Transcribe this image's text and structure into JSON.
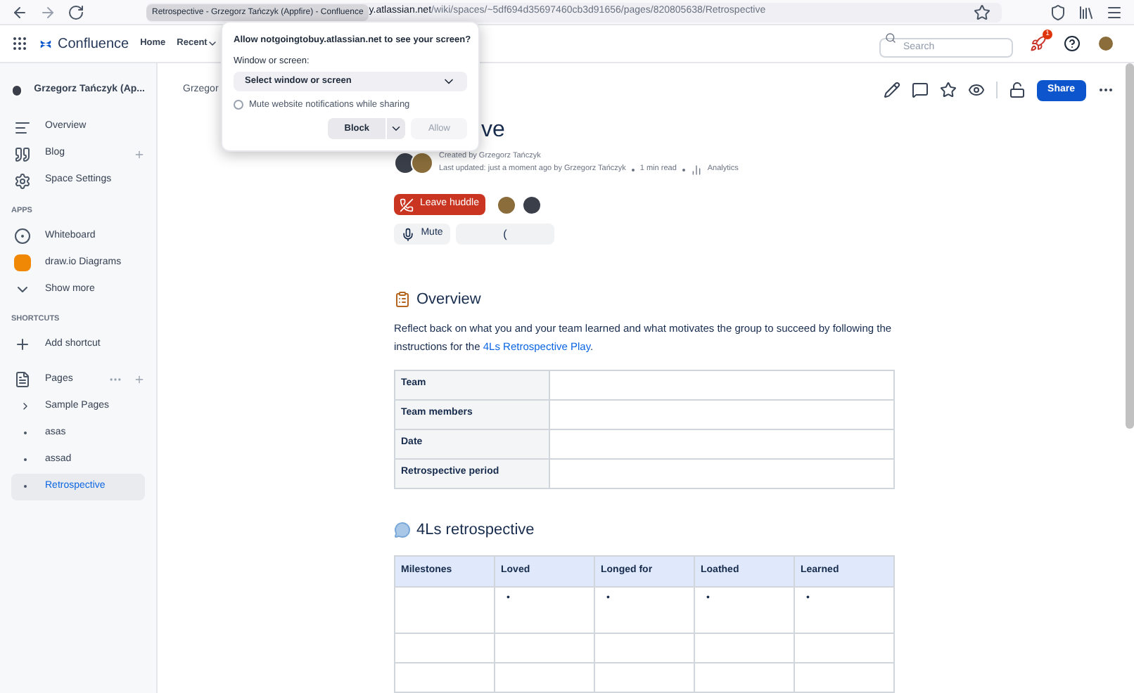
{
  "browser": {
    "tab_tooltip": "Retrospective - Grzegorz Tańczyk (Appfire) - Confluence",
    "url_host": "y.atlassian.net",
    "url_path": "/wiki/spaces/~5df694d35697460cb3d91656/pages/820805638/Retrospective"
  },
  "header": {
    "product": "Confluence",
    "nav": [
      {
        "label": "Home",
        "dropdown": false
      },
      {
        "label": "Recent",
        "dropdown": true
      }
    ],
    "search": {
      "placeholder": "Search"
    },
    "notification_count": "1"
  },
  "sidebar": {
    "space_name": "Grzegorz Tańczyk (Ap...",
    "items": [
      {
        "kind": "overview",
        "label": "Overview",
        "add": false
      },
      {
        "kind": "blog",
        "label": "Blog",
        "add": true
      },
      {
        "kind": "settings",
        "label": "Space Settings",
        "add": false
      }
    ],
    "apps_heading": "APPS",
    "apps": [
      {
        "kind": "whiteboard",
        "label": "Whiteboard"
      },
      {
        "kind": "drawio",
        "label": "draw.io Diagrams"
      },
      {
        "kind": "more",
        "label": "Show more"
      }
    ],
    "shortcuts_heading": "SHORTCUTS",
    "shortcuts": [
      {
        "label": "Add shortcut"
      }
    ],
    "pages": {
      "label": "Pages",
      "children": [
        {
          "label": "Sample Pages",
          "kind": "parent",
          "selected": false
        },
        {
          "label": "asas",
          "kind": "leaf",
          "selected": false
        },
        {
          "label": "assad",
          "kind": "leaf",
          "selected": false
        },
        {
          "label": "Retrospective",
          "kind": "leaf",
          "selected": true
        }
      ]
    }
  },
  "page": {
    "breadcrumb": "Grzegor",
    "title": "ve",
    "share": "Share",
    "created": "Created by Grzegorz Tańczyk",
    "updated": "Last updated: just a moment ago by Grzegorz Tańczyk",
    "read_time": "1 min read",
    "analytics": "Analytics",
    "huddle": {
      "leave": "Leave huddle",
      "mute": "Mute",
      "status": "("
    },
    "overview": {
      "heading": "Overview",
      "text_before": "Reflect back on what you and your team learned and what motivates the group to succeed by following the instructions for the ",
      "link": "4Ls Retrospective Play",
      "text_after": "."
    },
    "info_table": {
      "rows": [
        "Team",
        "Team members",
        "Date",
        "Retrospective period"
      ]
    },
    "retro": {
      "heading": "4Ls retrospective",
      "columns": [
        "Milestones",
        "Loved",
        "Longed for",
        "Loathed",
        "Learned"
      ],
      "rows": [
        {
          "cells": [
            {
              "bullet": false
            },
            {
              "bullet": true
            },
            {
              "bullet": true
            },
            {
              "bullet": true
            },
            {
              "bullet": true
            }
          ]
        },
        {
          "cells": [
            {
              "bullet": false
            },
            {
              "bullet": false
            },
            {
              "bullet": false
            },
            {
              "bullet": false
            },
            {
              "bullet": false
            }
          ]
        },
        {
          "cells": [
            {
              "bullet": false
            },
            {
              "bullet": false
            },
            {
              "bullet": false
            },
            {
              "bullet": false
            },
            {
              "bullet": false
            }
          ]
        }
      ],
      "bullet": "•"
    }
  },
  "dialog": {
    "title": "Allow notgoingtobuy.atlassian.net to see your screen?",
    "select_label": "Window or screen:",
    "select_value": "Select window or screen",
    "mute": {
      "label": "Mute website notifications while sharing",
      "checked": false
    },
    "block": "Block",
    "allow": {
      "label": "Allow",
      "disabled": true
    }
  }
}
